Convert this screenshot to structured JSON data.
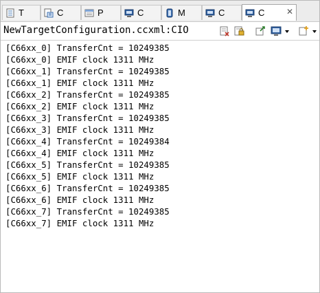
{
  "tabs": [
    {
      "label": "T",
      "icon": "task-list-icon"
    },
    {
      "label": "C",
      "icon": "cpu-file-icon"
    },
    {
      "label": "P",
      "icon": "properties-icon"
    },
    {
      "label": "C",
      "icon": "console-monitor-icon"
    },
    {
      "label": "M",
      "icon": "memory-icon"
    },
    {
      "label": "C",
      "icon": "console-monitor-icon"
    },
    {
      "label": "C",
      "icon": "console-monitor-icon",
      "close": "✕"
    }
  ],
  "console": {
    "title": "NewTargetConfiguration.ccxml:CIO",
    "toolbar": [
      "clear-console-icon",
      "scroll-lock-icon",
      "pin-console-icon",
      "display-console-icon",
      "dropdown-arrow-icon",
      "open-console-icon",
      "dropdown-arrow-icon"
    ],
    "lines": [
      "[C66xx_0] TransferCnt = 10249385",
      "[C66xx_0] EMIF clock 1311 MHz",
      "[C66xx_1] TransferCnt = 10249385",
      "[C66xx_1] EMIF clock 1311 MHz",
      "[C66xx_2] TransferCnt = 10249385",
      "[C66xx_2] EMIF clock 1311 MHz",
      "[C66xx_3] TransferCnt = 10249385",
      "[C66xx_3] EMIF clock 1311 MHz",
      "[C66xx_4] TransferCnt = 10249384",
      "[C66xx_4] EMIF clock 1311 MHz",
      "[C66xx_5] TransferCnt = 10249385",
      "[C66xx_5] EMIF clock 1311 MHz",
      "[C66xx_6] TransferCnt = 10249385",
      "[C66xx_6] EMIF clock 1311 MHz",
      "[C66xx_7] TransferCnt = 10249385",
      "[C66xx_7] EMIF clock 1311 MHz"
    ]
  }
}
